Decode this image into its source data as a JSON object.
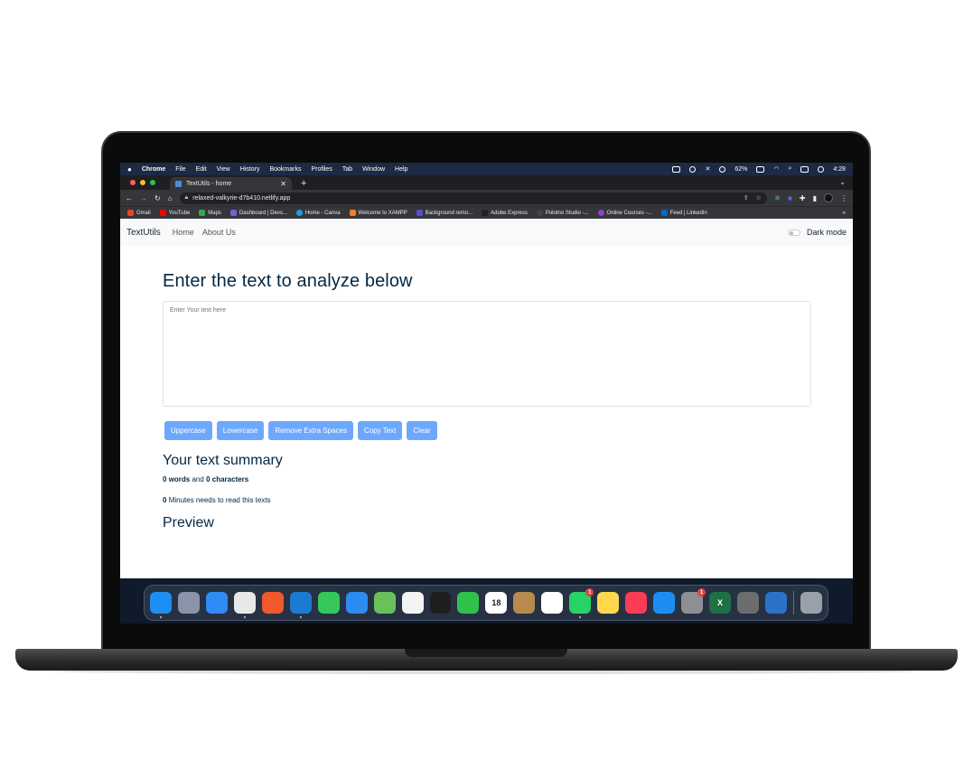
{
  "menubar": {
    "app": "Chrome",
    "items": [
      "File",
      "Edit",
      "View",
      "History",
      "Bookmarks",
      "Profiles",
      "Tab",
      "Window",
      "Help"
    ],
    "battery": "62%",
    "time": "4:28"
  },
  "browser": {
    "tab_title": "TextUtils - home",
    "new_tab": "+",
    "url": "relaxed-valkyrie-d7b410.netlify.app",
    "bookmarks": [
      {
        "label": "Gmail",
        "color": "#ea4335"
      },
      {
        "label": "YouTube",
        "color": "#ff0000"
      },
      {
        "label": "Maps",
        "color": "#34a853"
      },
      {
        "label": "Dashboard | Devs...",
        "color": "#7b5cd6"
      },
      {
        "label": "Home - Canva",
        "color": "#1aa0e0"
      },
      {
        "label": "Welcome to XAMPP",
        "color": "#fb7a24"
      },
      {
        "label": "Background remo...",
        "color": "#5b4cd6"
      },
      {
        "label": "Adobe Express",
        "color": "#222"
      },
      {
        "label": "Polotno Studio -...",
        "color": "#444"
      },
      {
        "label": "Online Courses -...",
        "color": "#8b3dd6"
      },
      {
        "label": "Feed | LinkedIn",
        "color": "#0a66c2"
      }
    ],
    "more": "»"
  },
  "navbar": {
    "brand": "TextUtils",
    "home": "Home",
    "about": "About Us",
    "dark_mode": "Dark mode"
  },
  "main": {
    "heading": "Enter the text to analyze below",
    "textarea_placeholder": "Enter Your text here",
    "buttons": {
      "uppercase": "Uppercase",
      "lowercase": "Lowercase",
      "remove_spaces": "Remove Extra Spaces",
      "copy": "Copy Text",
      "clear": "Clear"
    },
    "summary_heading": "Your text summary",
    "words_count": "0",
    "words_label": "words",
    "and_label": "and",
    "chars_count": "0",
    "chars_label": "characters",
    "minutes_count": "0",
    "minutes_label": "Minutes needs to read this texts",
    "preview_heading": "Preview"
  },
  "dock": {
    "apps": [
      {
        "name": "finder-icon",
        "color": "#1d8ff0",
        "running": true
      },
      {
        "name": "launchpad-icon",
        "color": "#8a93a8"
      },
      {
        "name": "safari-icon",
        "color": "#2f8bf5"
      },
      {
        "name": "chrome-icon",
        "color": "#e8e8e8",
        "running": true
      },
      {
        "name": "brave-icon",
        "color": "#f1582b"
      },
      {
        "name": "vscode-icon",
        "color": "#1b7bd3",
        "running": true
      },
      {
        "name": "messages-icon",
        "color": "#35c759"
      },
      {
        "name": "mail-icon",
        "color": "#2b8cf1"
      },
      {
        "name": "maps-icon",
        "color": "#6ac05a"
      },
      {
        "name": "photos-icon",
        "color": "#f4f4f4"
      },
      {
        "name": "terminal-icon",
        "color": "#1e1e1e"
      },
      {
        "name": "facetime-icon",
        "color": "#30c14d"
      },
      {
        "name": "calendar-icon",
        "color": "#ffffff",
        "label": "18"
      },
      {
        "name": "contacts-icon",
        "color": "#b88a4e"
      },
      {
        "name": "reminders-icon",
        "color": "#ffffff"
      },
      {
        "name": "whatsapp-icon",
        "color": "#25d366",
        "badge": "1",
        "running": true
      },
      {
        "name": "notes-icon",
        "color": "#ffd84d"
      },
      {
        "name": "music-icon",
        "color": "#fa3c55"
      },
      {
        "name": "app-store-icon",
        "color": "#1c8ef3"
      },
      {
        "name": "system-settings-icon",
        "color": "#8e8e93",
        "badge": "1"
      },
      {
        "name": "excel-icon",
        "color": "#1e7145",
        "label": "X"
      },
      {
        "name": "calculator-icon",
        "color": "#6d6d70"
      },
      {
        "name": "xampp-manager-icon",
        "color": "#2a73c9"
      },
      {
        "name": "trash-icon",
        "color": "#9aa0a8"
      }
    ]
  }
}
